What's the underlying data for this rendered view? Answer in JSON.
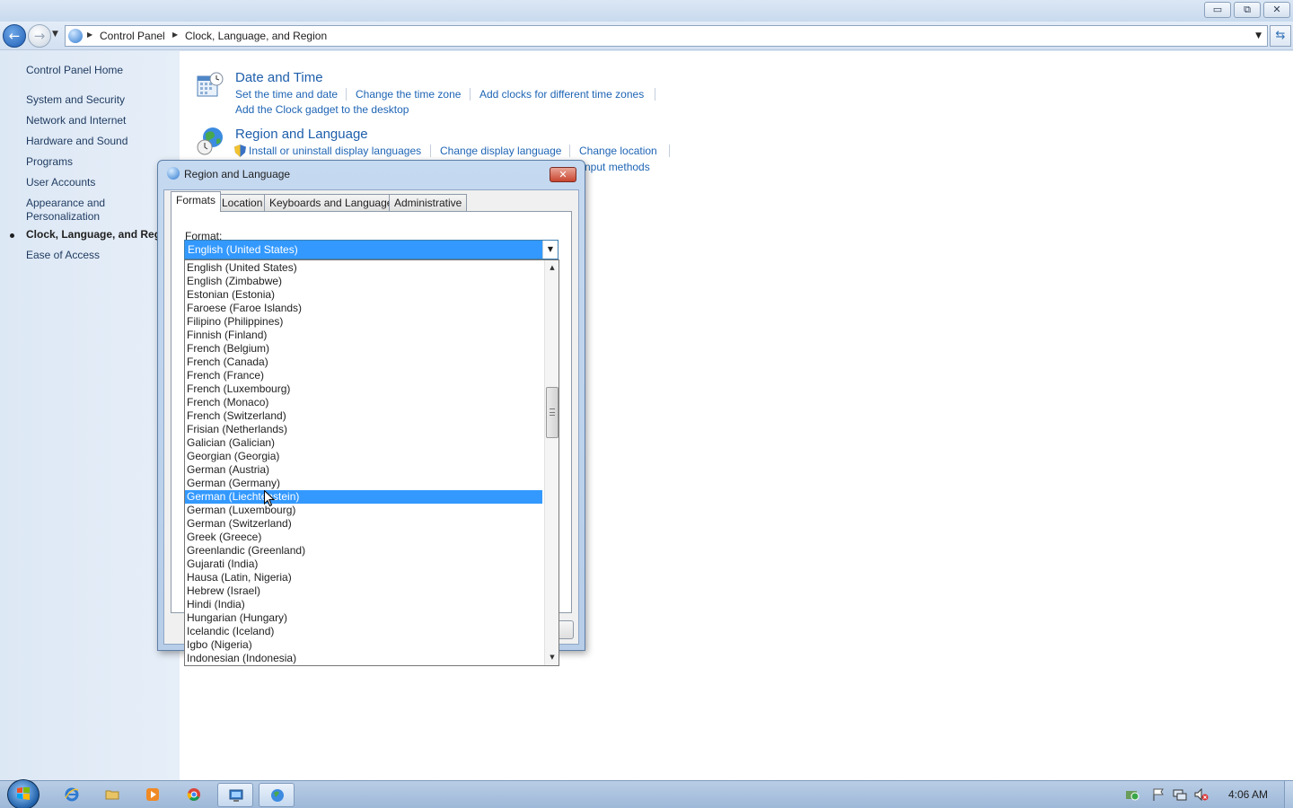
{
  "window": {
    "caption_buttons": {
      "minimize": "▭",
      "restore": "⧉",
      "close": "✕"
    }
  },
  "address_bar": {
    "crumbs": [
      "Control Panel",
      "Clock, Language, and Region"
    ],
    "refresh_icon": "refresh-icon"
  },
  "left_nav": {
    "items": [
      "Control Panel Home",
      "System and Security",
      "Network and Internet",
      "Hardware and Sound",
      "Programs",
      "User Accounts",
      "Appearance and Personalization",
      "Clock, Language, and Region",
      "Ease of Access"
    ],
    "current_index": 7
  },
  "main": {
    "date_time": {
      "title": "Date and Time",
      "links": [
        "Set the time and date",
        "Change the time zone",
        "Add clocks for different time zones",
        "Add the Clock gadget to the desktop"
      ]
    },
    "region_language": {
      "title": "Region and Language",
      "links": [
        "Install or uninstall display languages",
        "Change display language",
        "Change location",
        "nput methods"
      ]
    }
  },
  "dialog": {
    "title": "Region and Language",
    "close_label": "✕",
    "tabs": [
      "Formats",
      "Location",
      "Keyboards and Languages",
      "Administrative"
    ],
    "active_tab": "Formats",
    "format_label": "Format:",
    "format_value": "English (United States)",
    "dropdown_items": [
      "English (United States)",
      "English (Zimbabwe)",
      "Estonian (Estonia)",
      "Faroese (Faroe Islands)",
      "Filipino (Philippines)",
      "Finnish (Finland)",
      "French (Belgium)",
      "French (Canada)",
      "French (France)",
      "French (Luxembourg)",
      "French (Monaco)",
      "French (Switzerland)",
      "Frisian (Netherlands)",
      "Galician (Galician)",
      "Georgian (Georgia)",
      "German (Austria)",
      "German (Germany)",
      "German (Liechtenstein)",
      "German (Luxembourg)",
      "German (Switzerland)",
      "Greek (Greece)",
      "Greenlandic (Greenland)",
      "Gujarati (India)",
      "Hausa (Latin, Nigeria)",
      "Hebrew (Israel)",
      "Hindi (India)",
      "Hungarian (Hungary)",
      "Icelandic (Iceland)",
      "Igbo (Nigeria)",
      "Indonesian (Indonesia)"
    ],
    "highlighted_item": "German (Liechtenstein)"
  },
  "taskbar": {
    "items": [
      "internet-explorer-icon",
      "folder-icon",
      "media-player-icon",
      "chrome-icon",
      "remote-desktop-icon",
      "control-panel-icon"
    ],
    "tray": [
      "action-center-icon",
      "flag-icon",
      "network-icon",
      "volume-muted-icon"
    ],
    "clock": "4:06 AM"
  },
  "colors": {
    "link": "#1e64b4",
    "category_title": "#1e5eab",
    "selection": "#3399ff"
  }
}
